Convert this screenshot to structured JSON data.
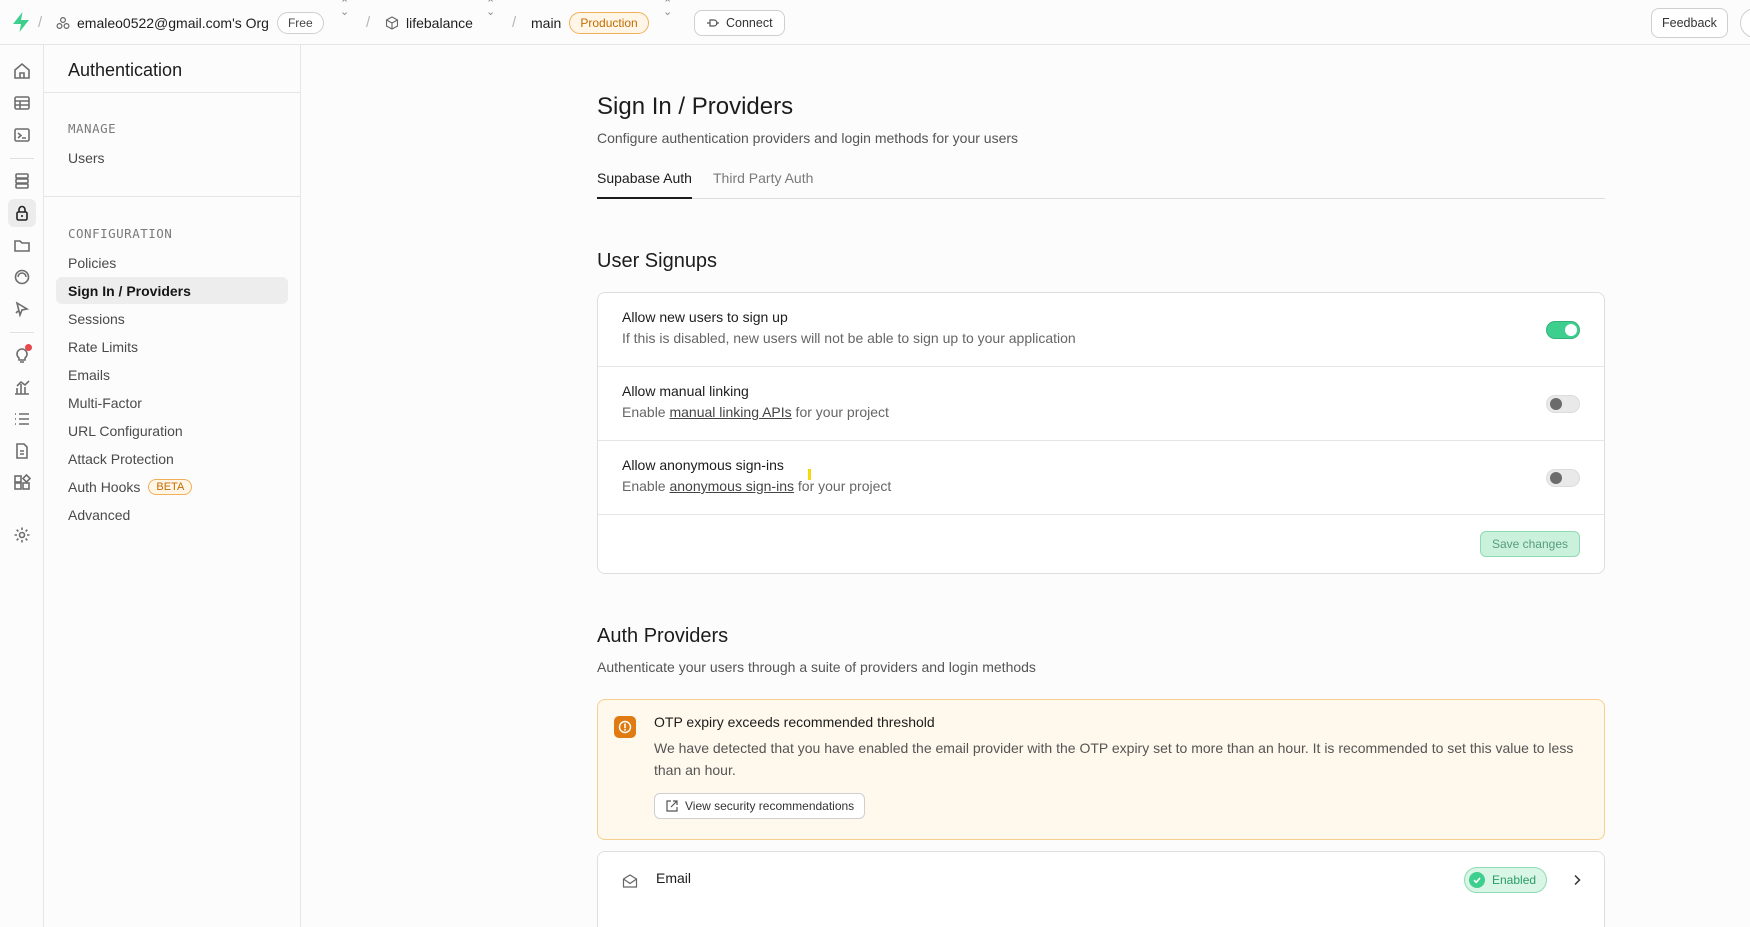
{
  "topbar": {
    "org_name": "emaleo0522@gmail.com's Org",
    "plan_badge": "Free",
    "project_name": "lifebalance",
    "branch_name": "main",
    "env_badge": "Production",
    "connect_label": "Connect",
    "feedback_label": "Feedback"
  },
  "subnav": {
    "title": "Authentication",
    "manage_label": "MANAGE",
    "manage_items": [
      "Users"
    ],
    "config_label": "CONFIGURATION",
    "config_items": [
      {
        "label": "Policies"
      },
      {
        "label": "Sign In / Providers",
        "active": true
      },
      {
        "label": "Sessions"
      },
      {
        "label": "Rate Limits"
      },
      {
        "label": "Emails"
      },
      {
        "label": "Multi-Factor"
      },
      {
        "label": "URL Configuration"
      },
      {
        "label": "Attack Protection"
      },
      {
        "label": "Auth Hooks",
        "badge": "BETA"
      },
      {
        "label": "Advanced"
      }
    ]
  },
  "page": {
    "title": "Sign In / Providers",
    "description": "Configure authentication providers and login methods for your users",
    "tabs": [
      {
        "label": "Supabase Auth",
        "active": true
      },
      {
        "label": "Third Party Auth",
        "active": false
      }
    ]
  },
  "user_signups": {
    "heading": "User Signups",
    "rows": [
      {
        "title": "Allow new users to sign up",
        "desc": "If this is disabled, new users will not be able to sign up to your application",
        "enabled": true
      },
      {
        "title": "Allow manual linking",
        "desc_prefix": "Enable ",
        "desc_link": "manual linking APIs",
        "desc_suffix": " for your project",
        "enabled": false
      },
      {
        "title": "Allow anonymous sign-ins",
        "desc_prefix": "Enable ",
        "desc_link": "anonymous sign-ins",
        "desc_suffix": " for your project",
        "enabled": false
      }
    ],
    "save_label": "Save changes"
  },
  "auth_providers": {
    "heading": "Auth Providers",
    "description": "Authenticate your users through a suite of providers and login methods",
    "warning": {
      "title": "OTP expiry exceeds recommended threshold",
      "text": "We have detected that you have enabled the email provider with the OTP expiry set to more than an hour. It is recommended to set this value to less than an hour.",
      "button_label": "View security recommendations"
    },
    "providers": [
      {
        "name": "Email",
        "status": "Enabled",
        "icon": "mail-icon"
      }
    ]
  },
  "colors": {
    "brand_green": "#3ecf8e",
    "warning_orange": "#e07a12",
    "production_badge": "#c26b00"
  }
}
